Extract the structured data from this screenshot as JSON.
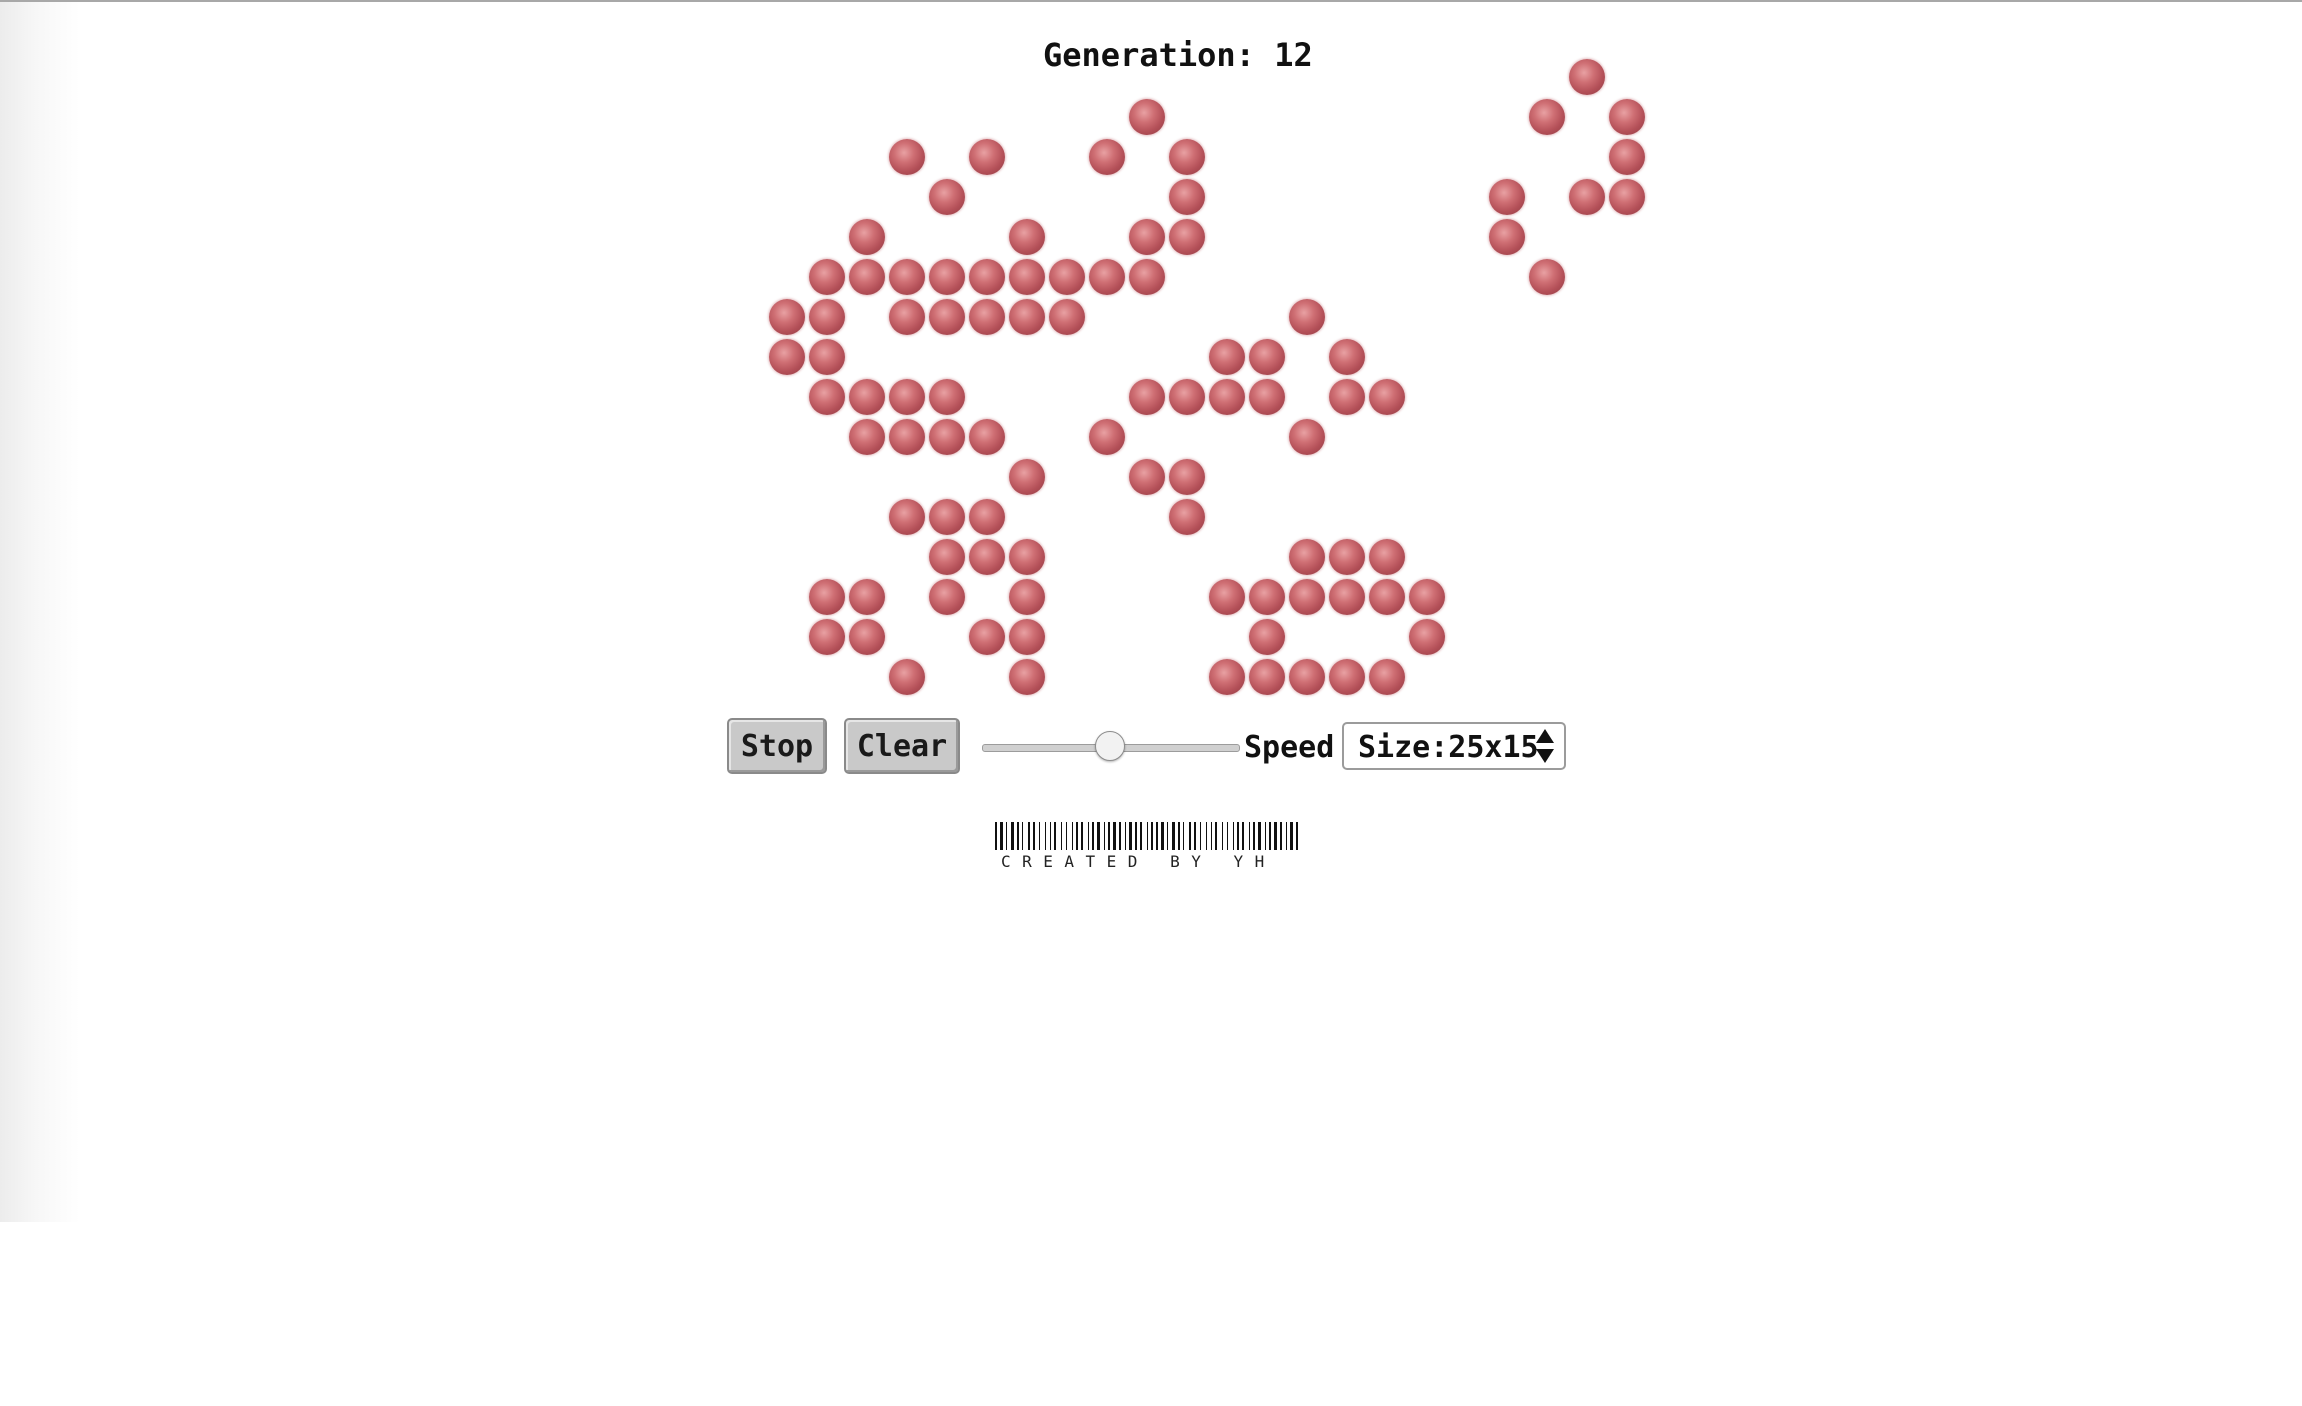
{
  "generation": {
    "text": "Generation: 12"
  },
  "board": {
    "columns": 25,
    "rows": 15,
    "cell_color": "#c25f67",
    "live_cells": [
      [
        9,
        0
      ],
      [
        3,
        1
      ],
      [
        5,
        1
      ],
      [
        8,
        1
      ],
      [
        10,
        1
      ],
      [
        4,
        2
      ],
      [
        10,
        2
      ],
      [
        2,
        3
      ],
      [
        6,
        3
      ],
      [
        9,
        3
      ],
      [
        10,
        3
      ],
      [
        1,
        4
      ],
      [
        2,
        4
      ],
      [
        3,
        4
      ],
      [
        4,
        4
      ],
      [
        5,
        4
      ],
      [
        6,
        4
      ],
      [
        7,
        4
      ],
      [
        8,
        4
      ],
      [
        9,
        4
      ],
      [
        19,
        4
      ],
      [
        0,
        5
      ],
      [
        1,
        5
      ],
      [
        3,
        5
      ],
      [
        4,
        5
      ],
      [
        5,
        5
      ],
      [
        6,
        5
      ],
      [
        7,
        5
      ],
      [
        13,
        5
      ],
      [
        0,
        6
      ],
      [
        1,
        6
      ],
      [
        11,
        6
      ],
      [
        12,
        6
      ],
      [
        14,
        6
      ],
      [
        1,
        7
      ],
      [
        2,
        7
      ],
      [
        3,
        7
      ],
      [
        4,
        7
      ],
      [
        9,
        7
      ],
      [
        10,
        7
      ],
      [
        11,
        7
      ],
      [
        12,
        7
      ],
      [
        14,
        7
      ],
      [
        15,
        7
      ],
      [
        2,
        8
      ],
      [
        3,
        8
      ],
      [
        4,
        8
      ],
      [
        5,
        8
      ],
      [
        8,
        8
      ],
      [
        13,
        8
      ],
      [
        6,
        9
      ],
      [
        9,
        9
      ],
      [
        10,
        9
      ],
      [
        3,
        10
      ],
      [
        4,
        10
      ],
      [
        5,
        10
      ],
      [
        10,
        10
      ],
      [
        4,
        11
      ],
      [
        5,
        11
      ],
      [
        6,
        11
      ],
      [
        13,
        11
      ],
      [
        14,
        11
      ],
      [
        15,
        11
      ],
      [
        1,
        12
      ],
      [
        2,
        12
      ],
      [
        4,
        12
      ],
      [
        6,
        12
      ],
      [
        11,
        12
      ],
      [
        12,
        12
      ],
      [
        13,
        12
      ],
      [
        14,
        12
      ],
      [
        15,
        12
      ],
      [
        16,
        12
      ],
      [
        1,
        13
      ],
      [
        2,
        13
      ],
      [
        5,
        13
      ],
      [
        6,
        13
      ],
      [
        12,
        13
      ],
      [
        16,
        13
      ],
      [
        3,
        14
      ],
      [
        6,
        14
      ],
      [
        11,
        14
      ],
      [
        12,
        14
      ],
      [
        13,
        14
      ],
      [
        14,
        14
      ],
      [
        15,
        14
      ]
    ],
    "extra_cells": [
      [
        20,
        -1
      ],
      [
        19,
        0
      ],
      [
        21,
        0
      ],
      [
        21,
        1
      ],
      [
        18,
        2
      ],
      [
        20,
        2
      ],
      [
        21,
        2
      ],
      [
        18,
        3
      ]
    ]
  },
  "controls": {
    "stop_label": "Stop",
    "clear_label": "Clear",
    "speed_label": "Speed",
    "speed_value": 0.5,
    "size_value": "Size:25x15"
  },
  "footer": {
    "credit": "CREATED BY YH"
  }
}
